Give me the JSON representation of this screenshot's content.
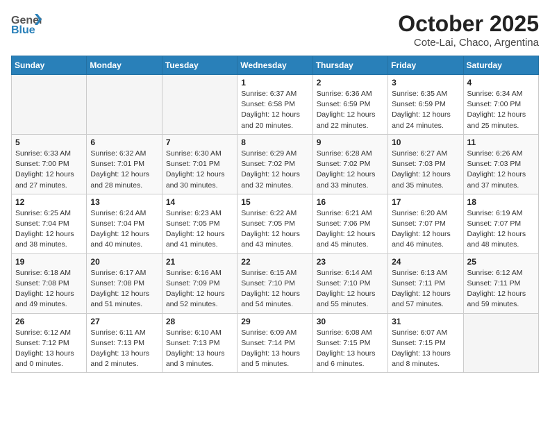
{
  "header": {
    "logo_general": "General",
    "logo_blue": "Blue",
    "month": "October 2025",
    "location": "Cote-Lai, Chaco, Argentina"
  },
  "weekdays": [
    "Sunday",
    "Monday",
    "Tuesday",
    "Wednesday",
    "Thursday",
    "Friday",
    "Saturday"
  ],
  "weeks": [
    [
      {
        "day": "",
        "info": ""
      },
      {
        "day": "",
        "info": ""
      },
      {
        "day": "",
        "info": ""
      },
      {
        "day": "1",
        "info": "Sunrise: 6:37 AM\nSunset: 6:58 PM\nDaylight: 12 hours\nand 20 minutes."
      },
      {
        "day": "2",
        "info": "Sunrise: 6:36 AM\nSunset: 6:59 PM\nDaylight: 12 hours\nand 22 minutes."
      },
      {
        "day": "3",
        "info": "Sunrise: 6:35 AM\nSunset: 6:59 PM\nDaylight: 12 hours\nand 24 minutes."
      },
      {
        "day": "4",
        "info": "Sunrise: 6:34 AM\nSunset: 7:00 PM\nDaylight: 12 hours\nand 25 minutes."
      }
    ],
    [
      {
        "day": "5",
        "info": "Sunrise: 6:33 AM\nSunset: 7:00 PM\nDaylight: 12 hours\nand 27 minutes."
      },
      {
        "day": "6",
        "info": "Sunrise: 6:32 AM\nSunset: 7:01 PM\nDaylight: 12 hours\nand 28 minutes."
      },
      {
        "day": "7",
        "info": "Sunrise: 6:30 AM\nSunset: 7:01 PM\nDaylight: 12 hours\nand 30 minutes."
      },
      {
        "day": "8",
        "info": "Sunrise: 6:29 AM\nSunset: 7:02 PM\nDaylight: 12 hours\nand 32 minutes."
      },
      {
        "day": "9",
        "info": "Sunrise: 6:28 AM\nSunset: 7:02 PM\nDaylight: 12 hours\nand 33 minutes."
      },
      {
        "day": "10",
        "info": "Sunrise: 6:27 AM\nSunset: 7:03 PM\nDaylight: 12 hours\nand 35 minutes."
      },
      {
        "day": "11",
        "info": "Sunrise: 6:26 AM\nSunset: 7:03 PM\nDaylight: 12 hours\nand 37 minutes."
      }
    ],
    [
      {
        "day": "12",
        "info": "Sunrise: 6:25 AM\nSunset: 7:04 PM\nDaylight: 12 hours\nand 38 minutes."
      },
      {
        "day": "13",
        "info": "Sunrise: 6:24 AM\nSunset: 7:04 PM\nDaylight: 12 hours\nand 40 minutes."
      },
      {
        "day": "14",
        "info": "Sunrise: 6:23 AM\nSunset: 7:05 PM\nDaylight: 12 hours\nand 41 minutes."
      },
      {
        "day": "15",
        "info": "Sunrise: 6:22 AM\nSunset: 7:05 PM\nDaylight: 12 hours\nand 43 minutes."
      },
      {
        "day": "16",
        "info": "Sunrise: 6:21 AM\nSunset: 7:06 PM\nDaylight: 12 hours\nand 45 minutes."
      },
      {
        "day": "17",
        "info": "Sunrise: 6:20 AM\nSunset: 7:07 PM\nDaylight: 12 hours\nand 46 minutes."
      },
      {
        "day": "18",
        "info": "Sunrise: 6:19 AM\nSunset: 7:07 PM\nDaylight: 12 hours\nand 48 minutes."
      }
    ],
    [
      {
        "day": "19",
        "info": "Sunrise: 6:18 AM\nSunset: 7:08 PM\nDaylight: 12 hours\nand 49 minutes."
      },
      {
        "day": "20",
        "info": "Sunrise: 6:17 AM\nSunset: 7:08 PM\nDaylight: 12 hours\nand 51 minutes."
      },
      {
        "day": "21",
        "info": "Sunrise: 6:16 AM\nSunset: 7:09 PM\nDaylight: 12 hours\nand 52 minutes."
      },
      {
        "day": "22",
        "info": "Sunrise: 6:15 AM\nSunset: 7:10 PM\nDaylight: 12 hours\nand 54 minutes."
      },
      {
        "day": "23",
        "info": "Sunrise: 6:14 AM\nSunset: 7:10 PM\nDaylight: 12 hours\nand 55 minutes."
      },
      {
        "day": "24",
        "info": "Sunrise: 6:13 AM\nSunset: 7:11 PM\nDaylight: 12 hours\nand 57 minutes."
      },
      {
        "day": "25",
        "info": "Sunrise: 6:12 AM\nSunset: 7:11 PM\nDaylight: 12 hours\nand 59 minutes."
      }
    ],
    [
      {
        "day": "26",
        "info": "Sunrise: 6:12 AM\nSunset: 7:12 PM\nDaylight: 13 hours\nand 0 minutes."
      },
      {
        "day": "27",
        "info": "Sunrise: 6:11 AM\nSunset: 7:13 PM\nDaylight: 13 hours\nand 2 minutes."
      },
      {
        "day": "28",
        "info": "Sunrise: 6:10 AM\nSunset: 7:13 PM\nDaylight: 13 hours\nand 3 minutes."
      },
      {
        "day": "29",
        "info": "Sunrise: 6:09 AM\nSunset: 7:14 PM\nDaylight: 13 hours\nand 5 minutes."
      },
      {
        "day": "30",
        "info": "Sunrise: 6:08 AM\nSunset: 7:15 PM\nDaylight: 13 hours\nand 6 minutes."
      },
      {
        "day": "31",
        "info": "Sunrise: 6:07 AM\nSunset: 7:15 PM\nDaylight: 13 hours\nand 8 minutes."
      },
      {
        "day": "",
        "info": ""
      }
    ]
  ]
}
